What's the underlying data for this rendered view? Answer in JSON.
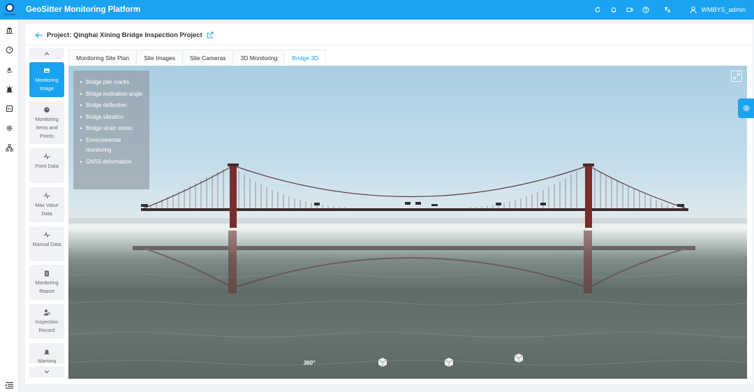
{
  "app": {
    "title": "GeoSitter Monitoring Platform",
    "logo_text": "GeoSitter"
  },
  "topbar": {
    "icons": [
      "refresh-icon",
      "bell-icon",
      "video-icon",
      "help-icon",
      "translate-icon"
    ],
    "user_name": "WMBYS_admin"
  },
  "rail": {
    "icons": [
      "bank-icon",
      "dashboard-icon",
      "amazon-icon",
      "alarm-icon",
      "report-icon",
      "gear-icon",
      "org-chart-icon",
      "menu-collapse-icon"
    ]
  },
  "breadcrumb": {
    "project_label": "Project: Qinghai Xining Bridge Inspection Project"
  },
  "menu": {
    "items": [
      {
        "label": "Monitoring Image",
        "icon": "image-icon",
        "active": true
      },
      {
        "label": "Monitoring Items and Points",
        "icon": "gauge-icon",
        "active": false
      },
      {
        "label": "Point Data",
        "icon": "pulse-icon",
        "active": false
      },
      {
        "label": "Max Value Data",
        "icon": "pulse-icon",
        "active": false
      },
      {
        "label": "Manual Data",
        "icon": "pulse-icon",
        "active": false
      },
      {
        "label": "Monitoring Report",
        "icon": "clipboard-icon",
        "active": false
      },
      {
        "label": "Inspection Record",
        "icon": "inspector-icon",
        "active": false
      },
      {
        "label": "Warning",
        "icon": "siren-icon",
        "active": false
      }
    ]
  },
  "tabs": [
    {
      "label": "Monitoring Site Plan",
      "active": false
    },
    {
      "label": "Site Images",
      "active": false
    },
    {
      "label": "Site Cameras",
      "active": false
    },
    {
      "label": "3D Monitoring",
      "active": false
    },
    {
      "label": "Bridge 3D",
      "active": true
    }
  ],
  "viewer": {
    "legend": [
      "Bridge pier cracks",
      "Bridge inclination angle",
      "Bridge deflection",
      "Bridge vibration",
      "Bridge strain stress",
      "Environmental monitoring",
      "GNSS deformation"
    ],
    "controls": {
      "rotate_label": "360°"
    }
  },
  "colors": {
    "accent": "#1aa3f0",
    "tower": "#7a2d2d",
    "water": "#5f6d69"
  }
}
